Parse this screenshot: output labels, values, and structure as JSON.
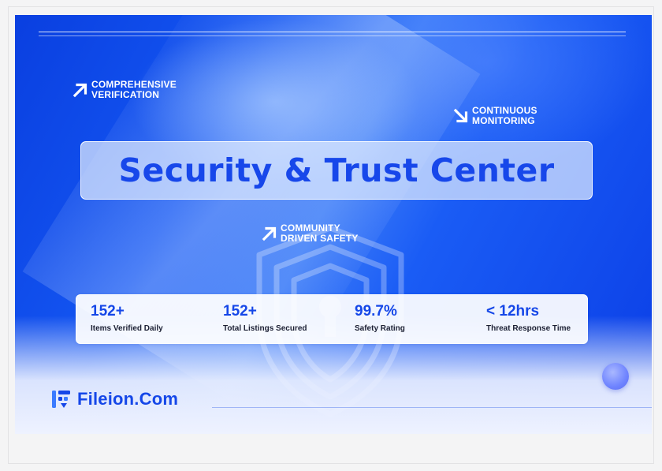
{
  "banner": {
    "title": "Security & Trust Center",
    "tags": {
      "verification": {
        "line1": "COMPREHENSIVE",
        "line2": "VERIFICATION",
        "icon": "arrow-up-right-icon"
      },
      "monitoring": {
        "line1": "CONTINUOUS",
        "line2": "MONITORING",
        "icon": "arrow-down-right-icon"
      },
      "community": {
        "line1": "COMMUNITY",
        "line2": "DRIVEN SAFETY",
        "icon": "arrow-up-right-icon"
      }
    },
    "stats": [
      {
        "value": "152+",
        "label": "Items Verified Daily"
      },
      {
        "value": "152+",
        "label": "Total Listings Secured"
      },
      {
        "value": "99.7%",
        "label": "Safety Rating"
      },
      {
        "value": "< 12hrs",
        "label": "Threat Response Time"
      }
    ],
    "brand": {
      "name": "Fileion.Com",
      "icon": "fileion-logo-icon"
    },
    "colors": {
      "accent": "#1547e8",
      "background": "#0b3ee6"
    }
  }
}
